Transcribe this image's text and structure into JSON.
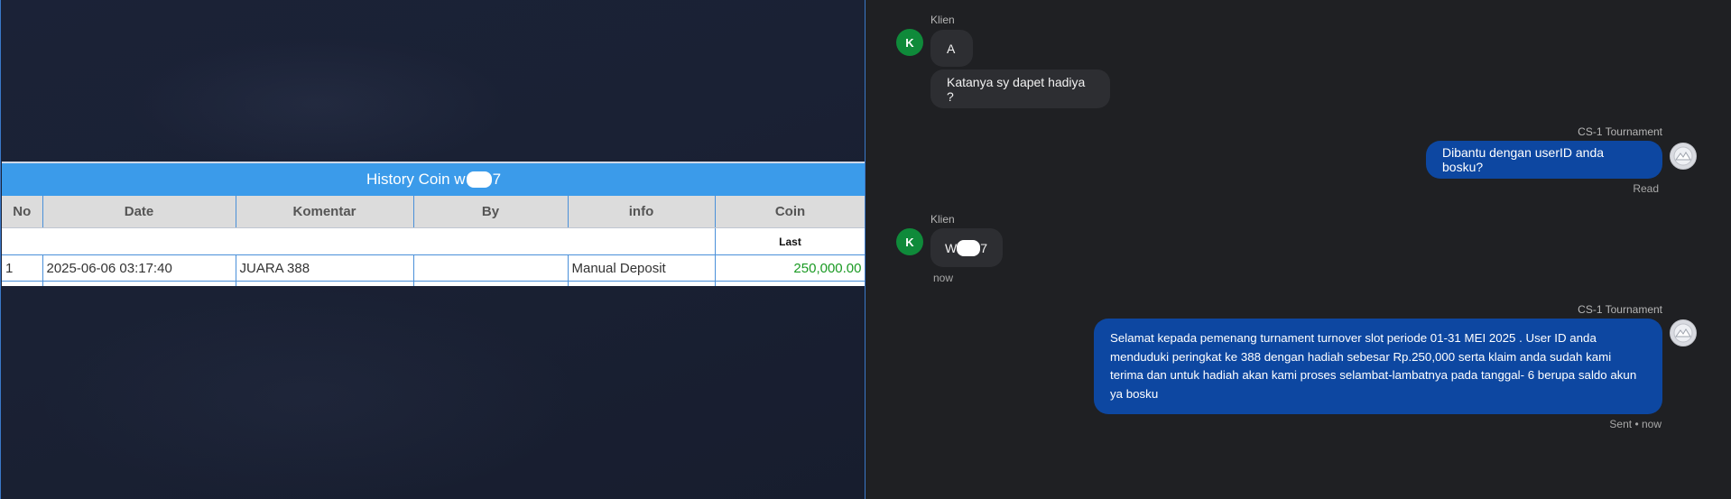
{
  "history": {
    "title_prefix": "History Coin w",
    "title_suffix": "7",
    "columns": [
      "No",
      "Date",
      "Komentar",
      "By",
      "info",
      "Coin"
    ],
    "subheader_coin": "Last",
    "rows": [
      {
        "no": "1",
        "date": "2025-06-06 03:17:40",
        "komentar": "JUARA 388",
        "by": "",
        "info": "Manual Deposit",
        "coin": "250,000.00"
      }
    ]
  },
  "chat": {
    "client_name": "Klien",
    "client_initial": "K",
    "agent_name": "CS-1 Tournament",
    "messages": [
      {
        "from": "client",
        "text": "A"
      },
      {
        "from": "client",
        "text": "Katanya sy dapet hadiya ?"
      },
      {
        "from": "agent",
        "text": "Dibantu dengan userID anda bosku?",
        "status": "Read"
      },
      {
        "from": "client",
        "text_prefix": "W",
        "text_suffix": "7",
        "time": "now"
      },
      {
        "from": "agent",
        "text": "Selamat kepada pemenang turnament turnover slot periode 01-31 MEI 2025 . User ID anda menduduki peringkat ke 388 dengan hadiah sebesar Rp.250,000 serta klaim anda sudah kami terima dan untuk hadiah akan kami proses selambat-lambatnya pada tanggal- 6 berupa saldo akun ya bosku",
        "status": "Sent • now"
      }
    ]
  },
  "colors": {
    "header_blue": "#3b9bea",
    "agent_bubble": "#0d47a1",
    "client_bubble": "#2d2e32",
    "client_avatar": "#0f8a3a",
    "coin_green": "#1a9a23"
  },
  "icons": {
    "agent_avatar": "mountain-avatar-icon"
  }
}
